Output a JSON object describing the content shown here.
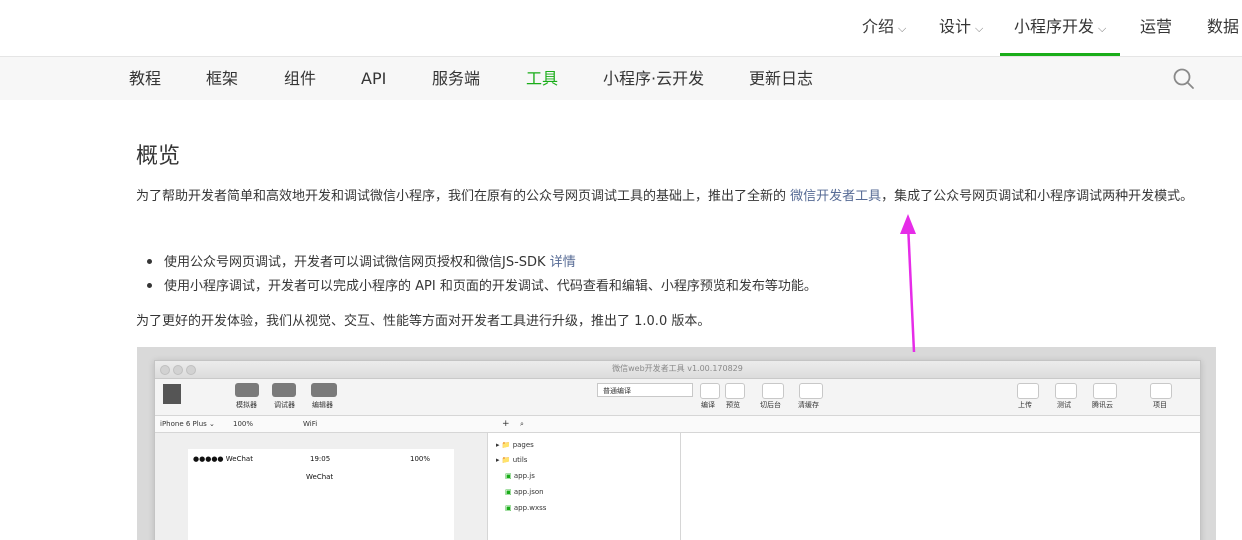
{
  "topnav": {
    "items": [
      {
        "label": "介绍",
        "dropdown": true
      },
      {
        "label": "设计",
        "dropdown": true
      },
      {
        "label": "小程序开发",
        "dropdown": true,
        "active": true
      },
      {
        "label": "运营",
        "dropdown": false
      },
      {
        "label": "数据",
        "dropdown": false
      }
    ]
  },
  "subnav": {
    "items": [
      "教程",
      "框架",
      "组件",
      "API",
      "服务端",
      "工具",
      "小程序·云开发",
      "更新日志"
    ],
    "active": "工具"
  },
  "content": {
    "title": "概览",
    "intro_before": "为了帮助开发者简单和高效地开发和调试微信小程序，我们在原有的公众号网页调试工具的基础上，推出了全新的 ",
    "intro_link": "微信开发者工具",
    "intro_after": "，集成了公众号网页调试和小程序调试两种开发模式。",
    "bullet1_text": "使用公众号网页调试，开发者可以调试微信网页授权和微信JS-SDK ",
    "bullet1_link": "详情",
    "bullet2_text": "使用小程序调试，开发者可以完成小程序的 API 和页面的开发调试、代码查看和编辑、小程序预览和发布等功能。",
    "outro": "为了更好的开发体验，我们从视觉、交互、性能等方面对开发者工具进行升级，推出了 1.0.0 版本。"
  },
  "screenshot": {
    "window_title": "微信web开发者工具 v1.00.170829",
    "toolbar_left": [
      "模拟器",
      "调试器",
      "编辑器"
    ],
    "compile_select": "普通编译",
    "toolbar_mid": [
      "编译",
      "预览",
      "切后台",
      "清缓存"
    ],
    "toolbar_right": [
      "上传",
      "测试",
      "腾讯云",
      "项目"
    ],
    "device": "iPhone 6 Plus",
    "zoom": "100%",
    "network": "WiFi",
    "phone_status_left": "●●●●● WeChat",
    "phone_time": "19:05",
    "phone_battery": "100%",
    "phone_title": "WeChat",
    "files": [
      "pages",
      "utils",
      "app.js",
      "app.json",
      "app.wxss"
    ]
  },
  "colors": {
    "accent": "#1aad19",
    "link": "#576b95",
    "arrow": "#e62ce8"
  }
}
